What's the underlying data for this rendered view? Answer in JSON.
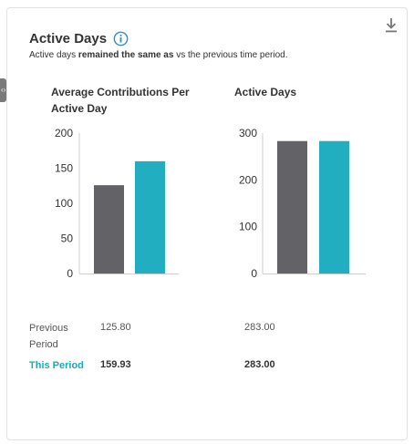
{
  "card": {
    "title": "Active Days",
    "subtitle_prefix": "Active days ",
    "subtitle_bold": "remained the same as",
    "subtitle_suffix": " vs the previous time period."
  },
  "icons": {
    "download": "download-icon",
    "info": "info-icon",
    "handle": "expand-handle-icon"
  },
  "colors": {
    "previous": "#626267",
    "current": "#21aec0",
    "accent": "#1aaab8",
    "info": "#2f8fd6"
  },
  "chart_data": [
    {
      "type": "bar",
      "title": "Average Contributions Per Active Day",
      "categories": [
        "Previous Period",
        "This Period"
      ],
      "values": [
        125.8,
        159.93
      ],
      "yticks": [
        0,
        50,
        100,
        150,
        200
      ],
      "ylim": [
        0,
        200
      ]
    },
    {
      "type": "bar",
      "title": "Active Days",
      "categories": [
        "Previous Period",
        "This Period"
      ],
      "values": [
        283.0,
        283.0
      ],
      "yticks": [
        0,
        100,
        200,
        300
      ],
      "ylim": [
        0,
        300
      ]
    }
  ],
  "summary": {
    "previous_label": "Previous Period",
    "this_label": "This Period",
    "contrib_previous": "125.80",
    "contrib_this": "159.93",
    "days_previous": "283.00",
    "days_this": "283.00"
  }
}
